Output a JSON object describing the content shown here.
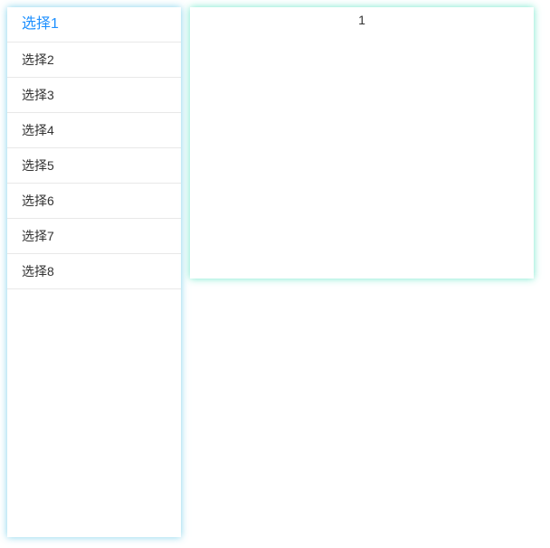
{
  "sidebar": {
    "items": [
      {
        "label": "选择1",
        "active": true
      },
      {
        "label": "选择2",
        "active": false
      },
      {
        "label": "选择3",
        "active": false
      },
      {
        "label": "选择4",
        "active": false
      },
      {
        "label": "选择5",
        "active": false
      },
      {
        "label": "选择6",
        "active": false
      },
      {
        "label": "选择7",
        "active": false
      },
      {
        "label": "选择8",
        "active": false
      }
    ]
  },
  "content": {
    "text": "1"
  }
}
